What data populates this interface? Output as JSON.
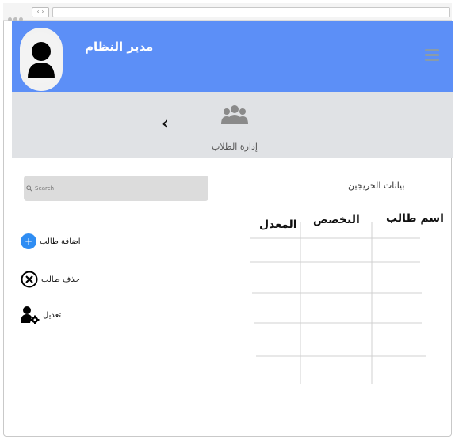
{
  "browser": {
    "nav_label": "‹ ›"
  },
  "header": {
    "title": "مدير النظام",
    "color": "#5c8ff7"
  },
  "toolbar": {
    "back_label": "‹",
    "section_label": "إدارة الطلاب"
  },
  "search": {
    "placeholder": "Search"
  },
  "graduates": {
    "title": "بيانات الخريجين",
    "columns": [
      "اسم طالب",
      "التخصص",
      "المعدل"
    ],
    "rows": [
      [
        "",
        "",
        ""
      ],
      [
        "",
        "",
        ""
      ],
      [
        "",
        "",
        ""
      ],
      [
        "",
        "",
        ""
      ]
    ]
  },
  "actions": {
    "add": "اضافة طالب",
    "delete": "حذف طالب",
    "edit": "تعديل"
  },
  "icons": {
    "avatar": "user-avatar-icon",
    "menu": "hamburger-menu-icon",
    "users": "users-group-icon",
    "search": "search-icon",
    "add": "plus-circle-icon",
    "delete": "x-circle-icon",
    "edit": "user-gear-icon"
  }
}
